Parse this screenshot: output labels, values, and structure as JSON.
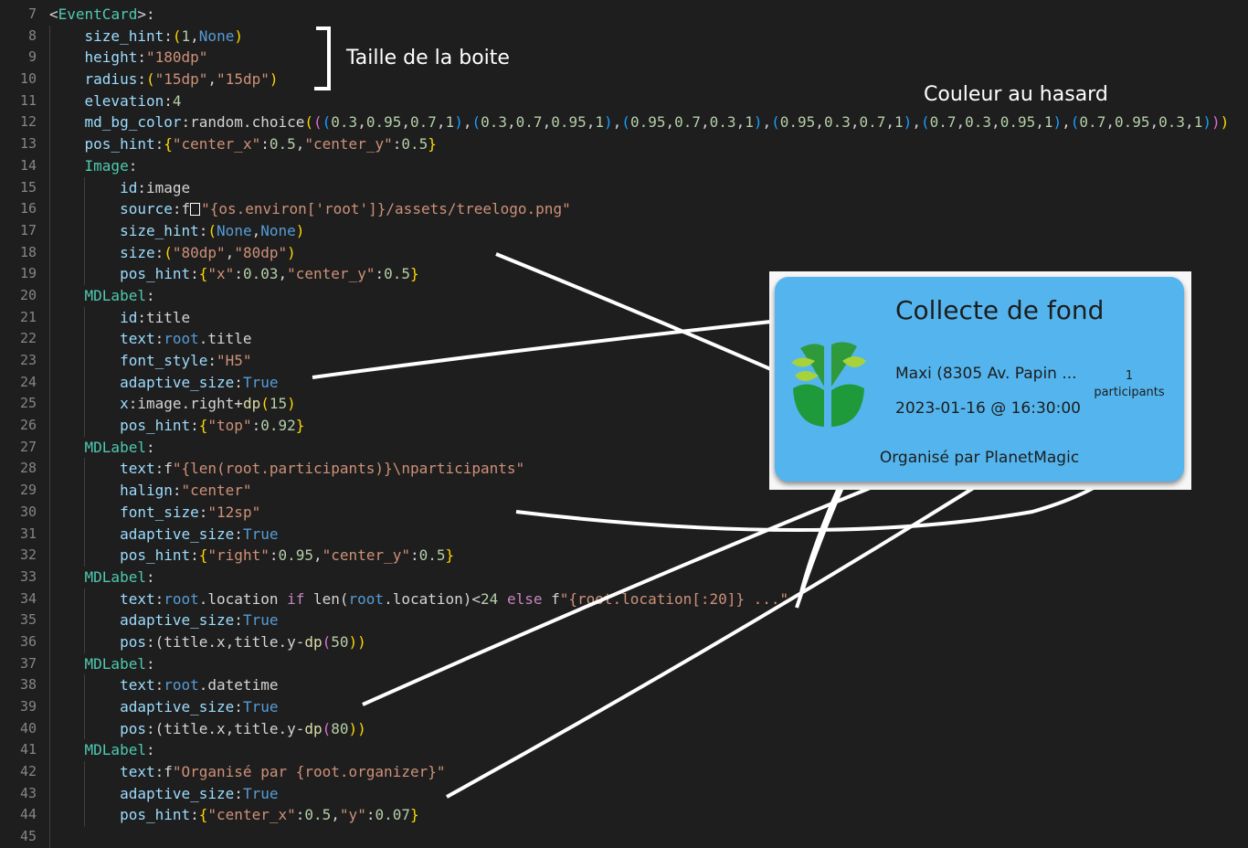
{
  "line_numbers": [
    "7",
    "8",
    "9",
    "10",
    "11",
    "12",
    "13",
    "14",
    "15",
    "16",
    "17",
    "18",
    "19",
    "20",
    "21",
    "22",
    "23",
    "24",
    "25",
    "26",
    "27",
    "28",
    "29",
    "30",
    "31",
    "32",
    "33",
    "34",
    "35",
    "36",
    "37",
    "38",
    "39",
    "40",
    "41",
    "42",
    "43",
    "44",
    "45"
  ],
  "code": {
    "l7": {
      "open": "<",
      "name": "EventCard",
      "close": ">:"
    },
    "l8": {
      "key": "size_hint",
      "colon": ":",
      "po": "(",
      "n1": "1",
      "comma": ",",
      "v2": "None",
      "pc": ")"
    },
    "l9": {
      "key": "height",
      "colon": ":",
      "val": "\"180dp\""
    },
    "l10": {
      "key": "radius",
      "colon": ":",
      "po": "(",
      "v1": "\"15dp\"",
      "comma": ",",
      "v2": "\"15dp\"",
      "pc": ")"
    },
    "l11": {
      "key": "elevation",
      "colon": ":",
      "val": "4"
    },
    "l12": {
      "key": "md_bg_color",
      "rest": ":random.choice(((0.3,0.95,0.7,1),(0.3,0.7,0.95,1),(0.95,0.7,0.3,1),(0.95,0.3,0.7,1),(0.7,0.3,0.95,1),(0.7,0.95,0.3,1)))"
    },
    "l13": {
      "key": "pos_hint",
      "colon": ":",
      "bo": "{",
      "k1": "\"center_x\"",
      "c1": ":",
      "n1": "0.5",
      "comma": ",",
      "k2": "\"center_y\"",
      "c2": ":",
      "n2": "0.5",
      "bc": "}"
    },
    "l14": {
      "widget": "Image",
      "colon": ":"
    },
    "l15": {
      "key": "id",
      "rest": ":image"
    },
    "l16": {
      "key": "source",
      "pre": ":f",
      "str": "\"{os.environ['root']}/assets/treelogo.png\""
    },
    "l17": {
      "key": "size_hint",
      "colon": ":",
      "po": "(",
      "v1": "None",
      "comma": ",",
      "v2": "None",
      "pc": ")"
    },
    "l18": {
      "key": "size",
      "colon": ":",
      "po": "(",
      "v1": "\"80dp\"",
      "comma": ",",
      "v2": "\"80dp\"",
      "pc": ")"
    },
    "l19": {
      "key": "pos_hint",
      "colon": ":",
      "bo": "{",
      "k1": "\"x\"",
      "c1": ":",
      "n1": "0.03",
      "comma": ",",
      "k2": "\"center_y\"",
      "c2": ":",
      "n2": "0.5",
      "bc": "}"
    },
    "l20": {
      "widget": "MDLabel",
      "colon": ":"
    },
    "l21": {
      "key": "id",
      "rest": ":title"
    },
    "l22": {
      "key": "text",
      "colon": ":",
      "root": "root",
      "rest": ".title"
    },
    "l23": {
      "key": "font_style",
      "colon": ":",
      "val": "\"H5\""
    },
    "l24": {
      "key": "adaptive_size",
      "colon": ":",
      "val": "True"
    },
    "l25": {
      "key": "x",
      "rest": ":image.right+",
      "fn": "dp",
      "po": "(",
      "n": "15",
      "pc": ")"
    },
    "l26": {
      "key": "pos_hint",
      "colon": ":",
      "bo": "{",
      "k1": "\"top\"",
      "c1": ":",
      "n1": "0.92",
      "bc": "}"
    },
    "l27": {
      "widget": "MDLabel",
      "colon": ":"
    },
    "l28": {
      "key": "text",
      "pre": ":f",
      "str": "\"{len(root.participants)}\\nparticipants\""
    },
    "l29": {
      "key": "halign",
      "colon": ":",
      "val": "\"center\""
    },
    "l30": {
      "key": "font_size",
      "colon": ":",
      "val": "\"12sp\""
    },
    "l31": {
      "key": "adaptive_size",
      "colon": ":",
      "val": "True"
    },
    "l32": {
      "key": "pos_hint",
      "colon": ":",
      "bo": "{",
      "k1": "\"right\"",
      "c1": ":",
      "n1": "0.95",
      "comma": ",",
      "k2": "\"center_y\"",
      "c2": ":",
      "n2": "0.5",
      "bc": "}"
    },
    "l33": {
      "widget": "MDLabel",
      "colon": ":"
    },
    "l34": {
      "key": "text",
      "colon": ":",
      "root": "root",
      "r1": ".location ",
      "kw1": "if",
      "r2": " len(",
      "root2": "root",
      "r3": ".location)<",
      "n": "24",
      "sp": " ",
      "kw2": "else",
      "r4": " f",
      "str": "\"{root.location[:20]} ...\""
    },
    "l35": {
      "key": "adaptive_size",
      "colon": ":",
      "val": "True"
    },
    "l36": {
      "key": "pos",
      "rest": ":(title.x,title.y-",
      "fn": "dp",
      "po": "(",
      "n": "50",
      "pc": "))"
    },
    "l37": {
      "widget": "MDLabel",
      "colon": ":"
    },
    "l38": {
      "key": "text",
      "colon": ":",
      "root": "root",
      "rest": ".datetime"
    },
    "l39": {
      "key": "adaptive_size",
      "colon": ":",
      "val": "True"
    },
    "l40": {
      "key": "pos",
      "rest": ":(title.x,title.y-",
      "fn": "dp",
      "po": "(",
      "n": "80",
      "pc": "))"
    },
    "l41": {
      "widget": "MDLabel",
      "colon": ":"
    },
    "l42": {
      "key": "text",
      "pre": ":f",
      "str": "\"Organisé par {root.organizer}\""
    },
    "l43": {
      "key": "adaptive_size",
      "colon": ":",
      "val": "True"
    },
    "l44": {
      "key": "pos_hint",
      "colon": ":",
      "bo": "{",
      "k1": "\"center_x\"",
      "c1": ":",
      "n1": "0.5",
      "comma": ",",
      "k2": "\"y\"",
      "c2": ":",
      "n2": "0.07",
      "bc": "}"
    }
  },
  "annotations": {
    "size_label": "Taille de la boite",
    "color_label": "Couleur au hasard"
  },
  "card": {
    "title": "Collecte de fond",
    "location": "Maxi (8305 Av. Papin ...",
    "datetime": "2023-01-16 @ 16:30:00",
    "participants_count": "1",
    "participants_label": "participants",
    "organizer": "Organisé par PlanetMagic",
    "bg_color": "#54b5ee",
    "logo_icon": "tree-logo-icon"
  },
  "colors": {
    "editor_bg": "#1e1e1e",
    "property": "#9cdcfe",
    "string": "#ce9178",
    "number": "#b5cea8",
    "keyword_const": "#569cd6",
    "class_name": "#4ec9b0",
    "annotation": "#ffffff"
  }
}
